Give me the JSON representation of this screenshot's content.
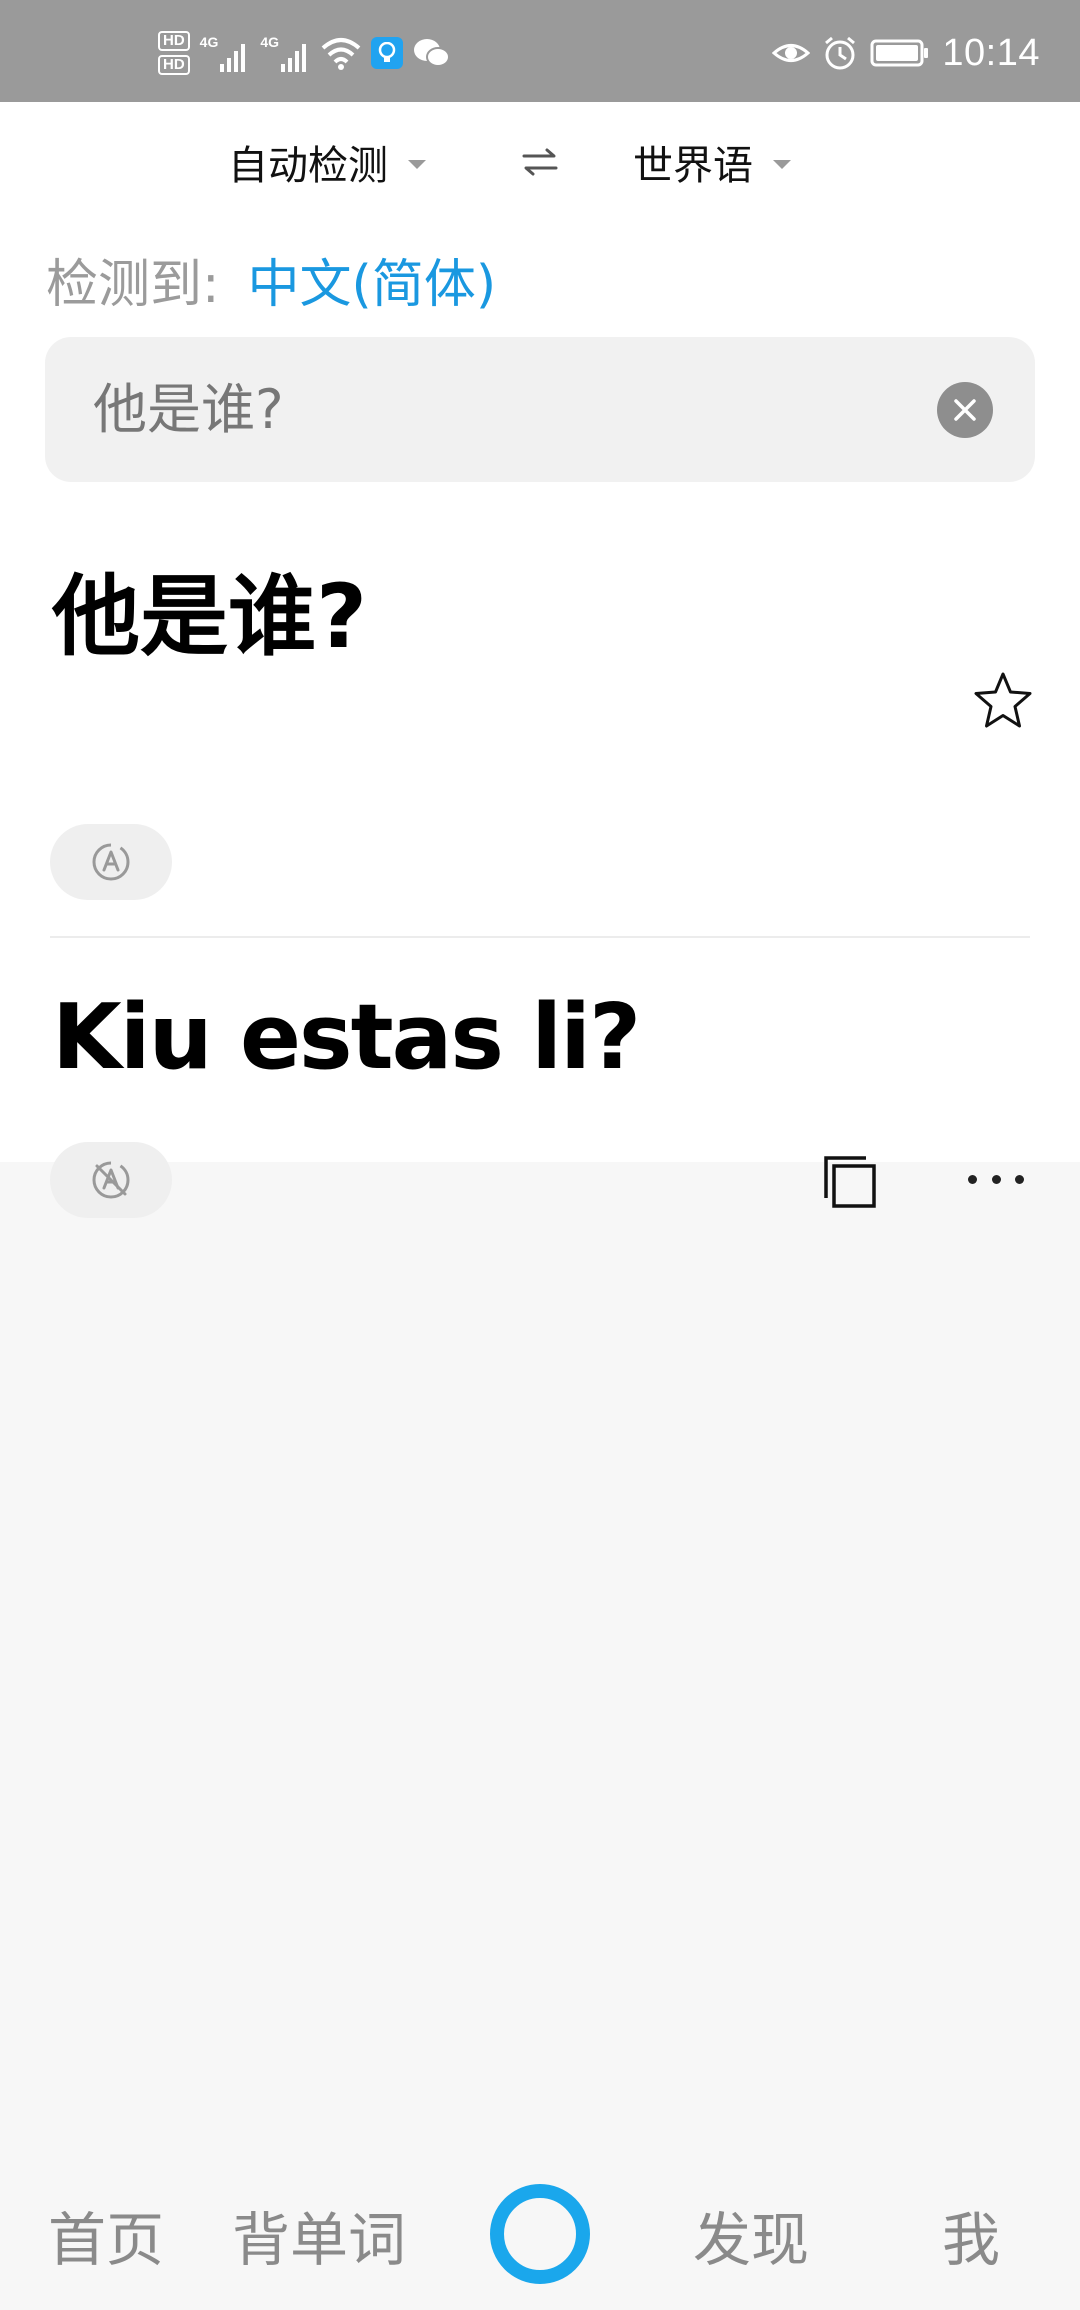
{
  "status_bar": {
    "hd1": "HD",
    "hd2": "HD",
    "net1": "4G",
    "net2": "4G",
    "time": "10:14",
    "icons": [
      "hd-icon",
      "signal-icon",
      "wifi-icon",
      "light-app-icon",
      "wechat-icon",
      "eye-icon",
      "alarm-icon",
      "battery-icon"
    ]
  },
  "lang_bar": {
    "source_lang": "自动检测",
    "target_lang": "世界语"
  },
  "detected": {
    "label": "检测到:",
    "lang": "中文(简体)"
  },
  "input": {
    "value": "他是谁?"
  },
  "source": {
    "text": "他是谁?"
  },
  "result": {
    "text": "Kiu estas li?"
  },
  "nav": {
    "home": "首页",
    "words": "背单词",
    "discover": "发现",
    "me": "我"
  },
  "colors": {
    "accent": "#1a98e0",
    "nav_center": "#1aa7ec",
    "status_bar": "#9a9a9a"
  }
}
